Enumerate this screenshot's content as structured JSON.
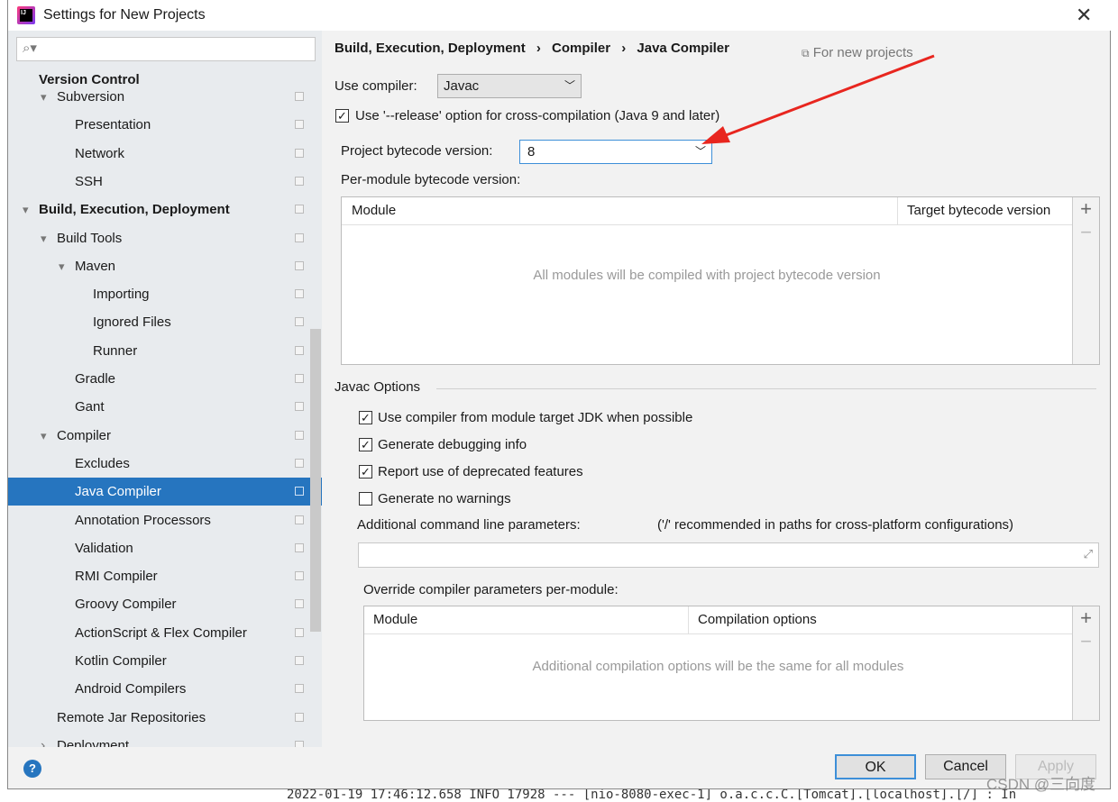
{
  "window": {
    "title": "Settings for New Projects",
    "close_icon": "close-icon"
  },
  "search": {
    "placeholder": ""
  },
  "sidebar": {
    "items": [
      {
        "label": "Version Control",
        "level": 0,
        "bold": true,
        "expanded": true
      },
      {
        "label": "Subversion",
        "level": 1,
        "expanded": true
      },
      {
        "label": "Presentation",
        "level": 2
      },
      {
        "label": "Network",
        "level": 2
      },
      {
        "label": "SSH",
        "level": 2
      },
      {
        "label": "Build, Execution, Deployment",
        "level": 0,
        "bold": true,
        "expanded": true
      },
      {
        "label": "Build Tools",
        "level": 1,
        "expanded": true
      },
      {
        "label": "Maven",
        "level": 2,
        "expanded": true
      },
      {
        "label": "Importing",
        "level": 3
      },
      {
        "label": "Ignored Files",
        "level": 3
      },
      {
        "label": "Runner",
        "level": 3
      },
      {
        "label": "Gradle",
        "level": 2
      },
      {
        "label": "Gant",
        "level": 2
      },
      {
        "label": "Compiler",
        "level": 1,
        "expanded": true
      },
      {
        "label": "Excludes",
        "level": 2
      },
      {
        "label": "Java Compiler",
        "level": 2,
        "selected": true
      },
      {
        "label": "Annotation Processors",
        "level": 2
      },
      {
        "label": "Validation",
        "level": 2
      },
      {
        "label": "RMI Compiler",
        "level": 2
      },
      {
        "label": "Groovy Compiler",
        "level": 2
      },
      {
        "label": "ActionScript & Flex Compiler",
        "level": 2
      },
      {
        "label": "Kotlin Compiler",
        "level": 2
      },
      {
        "label": "Android Compilers",
        "level": 2
      },
      {
        "label": "Remote Jar Repositories",
        "level": 1
      },
      {
        "label": "Deployment",
        "level": 1,
        "collapsed": true
      }
    ]
  },
  "breadcrumb": [
    "Build, Execution, Deployment",
    "Compiler",
    "Java Compiler"
  ],
  "breadcrumb_sep": "›",
  "for_new_projects": "For new projects",
  "compiler": {
    "label": "Use compiler:",
    "value": "Javac"
  },
  "release_option": {
    "label": "Use '--release' option for cross-compilation (Java 9 and later)",
    "checked": true
  },
  "bytecode": {
    "label": "Project bytecode version:",
    "value": "8"
  },
  "per_module": {
    "label": "Per-module bytecode version:",
    "col_module": "Module",
    "col_target": "Target bytecode version",
    "empty": "All modules will be compiled with project bytecode version"
  },
  "javac": {
    "title": "Javac Options",
    "options": [
      {
        "label": "Use compiler from module target JDK when possible",
        "checked": true
      },
      {
        "label": "Generate debugging info",
        "checked": true
      },
      {
        "label": "Report use of deprecated features",
        "checked": true
      },
      {
        "label": "Generate no warnings",
        "checked": false
      }
    ],
    "cmd_label": "Additional command line parameters:",
    "cmd_hint": "('/' recommended in paths for cross-platform configurations)",
    "cmd_value": ""
  },
  "override": {
    "label": "Override compiler parameters per-module:",
    "col_module": "Module",
    "col_options": "Compilation options",
    "empty": "Additional compilation options will be the same for all modules"
  },
  "table_actions": {
    "add": "+",
    "remove": "−"
  },
  "buttons": {
    "ok": "OK",
    "cancel": "Cancel",
    "apply": "Apply",
    "help": "?"
  },
  "watermark": "CSDN @三向度",
  "background_log": "2022-01-19 17:46:12.658  INFO 17928 --- [nio-8080-exec-1] o.a.c.c.C.[Tomcat].[localhost].[/]       : In",
  "colors": {
    "selection": "#2675bf",
    "annotation_arrow": "#e8261f",
    "focus": "#3d8fd8"
  }
}
